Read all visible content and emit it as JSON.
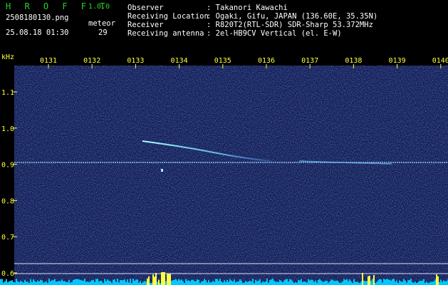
{
  "header": {
    "logo": "H R O F F T",
    "version": "1.0.0",
    "filename": "2508180130.png",
    "datetime": "25.08.18 01:30",
    "meteor_label": "meteor",
    "meteor_count": "29",
    "info": [
      {
        "label": "Observer",
        "value": ": Takanori Kawachi"
      },
      {
        "label": "Receiving Location",
        "value": ": Ogaki, Gifu, JAPAN (136.60E, 35.35N)"
      },
      {
        "label": "Receiver",
        "value": ": R820T2(RTL-SDR) SDR-Sharp 53.372MHz"
      },
      {
        "label": "Receiving antenna",
        "value": ": 2el-HB9CV Vertical (el. E-W)"
      }
    ]
  },
  "spectrogram": {
    "unit_label": "kHz",
    "time_ticks": [
      "0131",
      "0132",
      "0133",
      "0134",
      "0135",
      "0136",
      "0137",
      "0138",
      "0139",
      "0140"
    ],
    "freq_ticks": [
      "1.1",
      "1.0",
      "0.9",
      "0.8",
      "0.7",
      "0.6"
    ],
    "colors": {
      "background": "#0b1040",
      "trace": "#7fe8ff",
      "carrier": "#9fd8ff",
      "signal_strip": "#00d0ff"
    }
  }
}
